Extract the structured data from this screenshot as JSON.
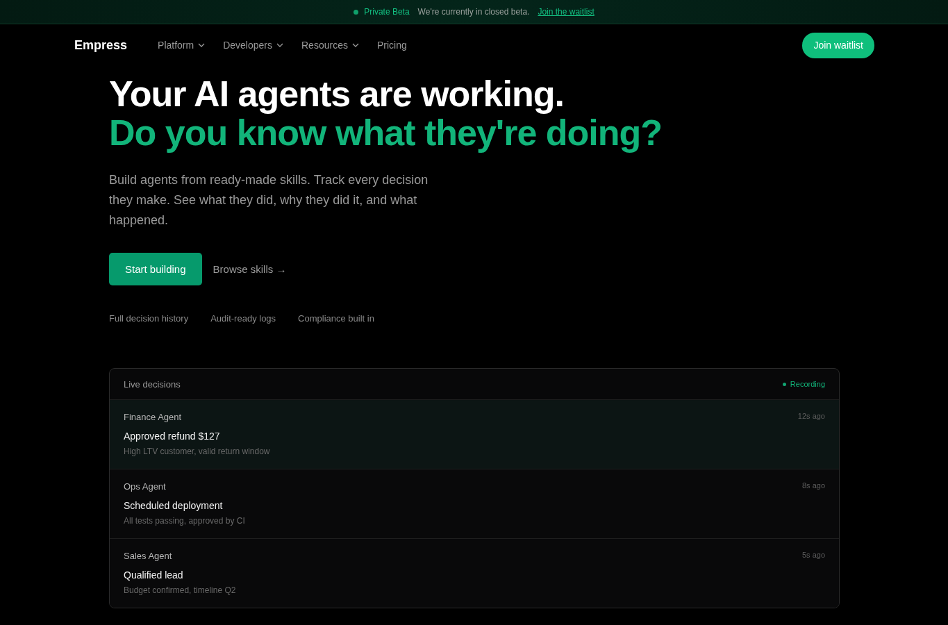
{
  "banner": {
    "badge": "Private Beta",
    "message": "We're currently in closed beta.",
    "link": "Join the waitlist"
  },
  "nav": {
    "brand": "Empress",
    "items": [
      {
        "label": "Platform",
        "has_menu": true
      },
      {
        "label": "Developers",
        "has_menu": true
      },
      {
        "label": "Resources",
        "has_menu": true
      },
      {
        "label": "Pricing",
        "has_menu": false
      }
    ],
    "cta": "Join waitlist"
  },
  "hero": {
    "title": "Your AI agents are working.",
    "title_accent": "Do you know what they're doing?",
    "lead": "Build agents from ready-made skills. Track every decision they make. See what they did, why they did it, and what happened.",
    "primary_button": "Start building",
    "secondary_link": "Browse skills →",
    "features": [
      "Full decision history",
      "Audit-ready logs",
      "Compliance built in"
    ]
  },
  "live_panel": {
    "title": "Live decisions",
    "status": "Recording",
    "recording": true,
    "decisions": [
      {
        "agent": "Finance Agent",
        "time": "12s ago",
        "action": "Approved refund $127",
        "reason": "High LTV customer, valid return window",
        "highlighted": true
      },
      {
        "agent": "Ops Agent",
        "time": "8s ago",
        "action": "Scheduled deployment",
        "reason": "All tests passing, approved by CI",
        "highlighted": false
      },
      {
        "agent": "Sales Agent",
        "time": "5s ago",
        "action": "Qualified lead",
        "reason": "Budget confirmed, timeline Q2",
        "highlighted": false
      }
    ]
  }
}
